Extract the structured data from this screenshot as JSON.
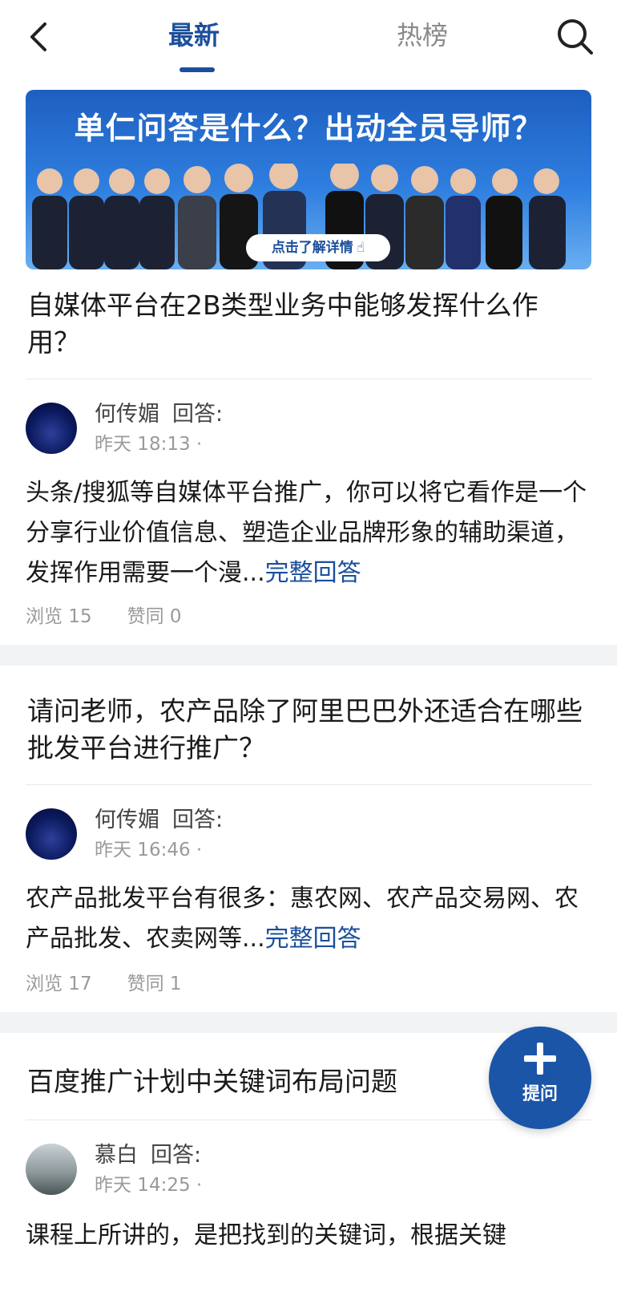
{
  "header": {
    "tabs": [
      {
        "label": "最新",
        "active": true
      },
      {
        "label": "热榜",
        "active": false
      }
    ],
    "accent_color": "#1b4f9c"
  },
  "banner": {
    "title": "单仁问答是什么？出动全员导师？",
    "cta": "点击了解详情"
  },
  "questions": [
    {
      "title": "自媒体平台在2B类型业务中能够发挥什么作用？",
      "author": "何传媚",
      "role": "回答:",
      "time": "昨天 18:13 ·",
      "answer": "头条/搜狐等自媒体平台推广，你可以将它看作是一个分享行业价值信息、塑造企业品牌形象的辅助渠道，发挥作用需要一个漫...",
      "more": "完整回答",
      "views": "浏览 15",
      "likes": "赞同 0"
    },
    {
      "title": "请问老师，农产品除了阿里巴巴外还适合在哪些批发平台进行推广？",
      "author": "何传媚",
      "role": "回答:",
      "time": "昨天 16:46 ·",
      "answer": "农产品批发平台有很多：惠农网、农产品交易网、农产品批发、农卖网等...",
      "more": "完整回答",
      "views": "浏览 17",
      "likes": "赞同 1"
    },
    {
      "title": "百度推广计划中关键词布局问题",
      "author": "慕白",
      "role": "回答:",
      "time": "昨天 14:25 ·",
      "answer": "课程上所讲的，是把找到的关键词，根据关键"
    }
  ],
  "fab": {
    "label": "提问",
    "color": "#1b55a8"
  }
}
